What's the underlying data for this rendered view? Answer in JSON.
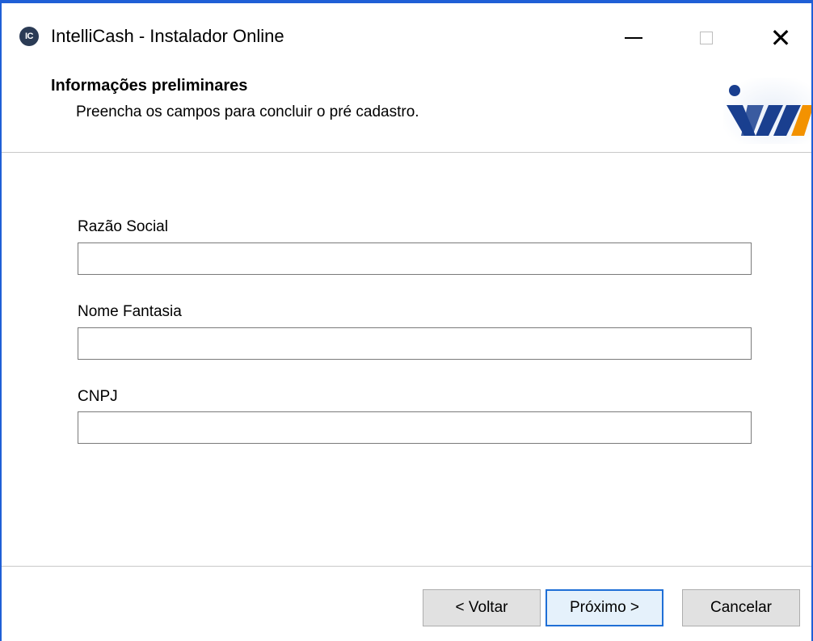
{
  "window": {
    "title": "IntelliCash - Instalador Online",
    "icon_text": "IC",
    "controls": {
      "minimize": "minimize",
      "maximize": "maximize",
      "close": "close"
    }
  },
  "header": {
    "title": "Informações preliminares",
    "subtitle": "Preencha os campos para concluir o pré cadastro.",
    "logo": "intellicash-logo"
  },
  "form": {
    "fields": [
      {
        "label": "Razão Social",
        "value": "",
        "placeholder": ""
      },
      {
        "label": "Nome Fantasia",
        "value": "",
        "placeholder": ""
      },
      {
        "label": "CNPJ",
        "value": "",
        "placeholder": ""
      }
    ]
  },
  "buttons": {
    "back": "< Voltar",
    "next": "Próximo >",
    "cancel": "Cancelar"
  },
  "colors": {
    "window_border": "#1f5fd6",
    "default_button_border": "#1f6fd6",
    "logo_blue": "#1a3f8f",
    "logo_orange": "#f39200"
  }
}
